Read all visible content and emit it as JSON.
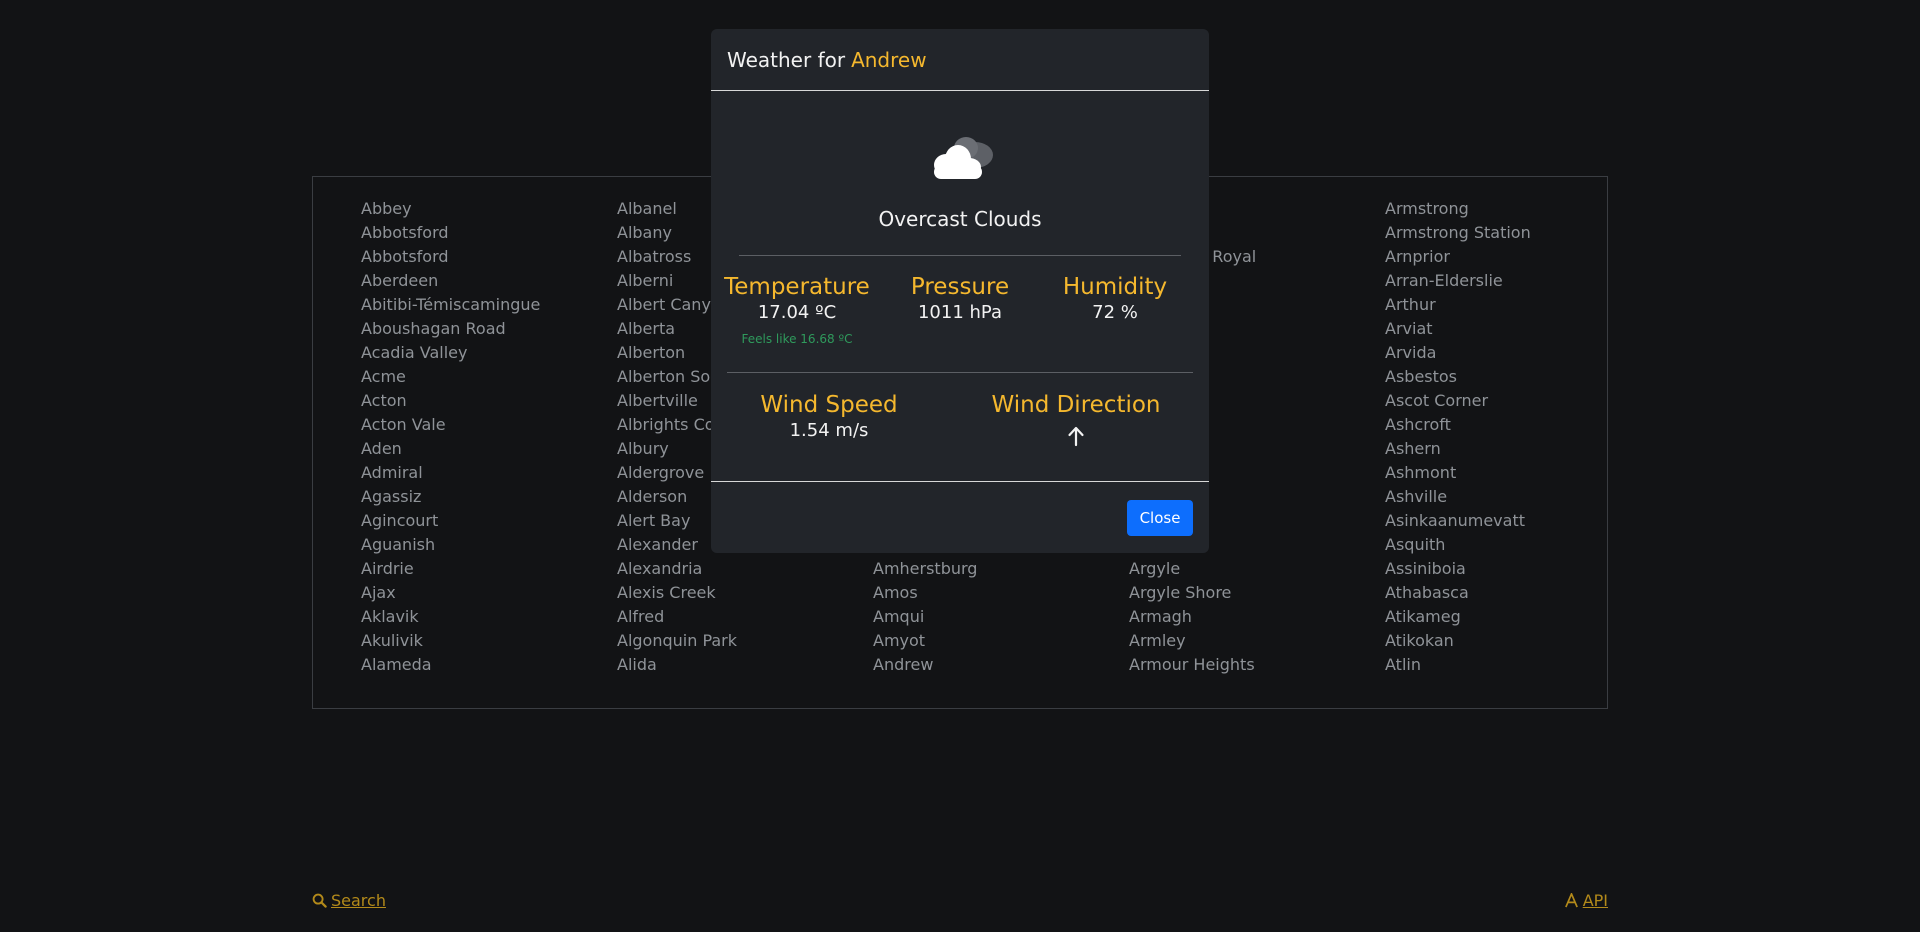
{
  "cities": {
    "col1": [
      "Abbey",
      "Abbotsford",
      "Abbotsford",
      "Aberdeen",
      "Abitibi-Témiscamingue",
      "Aboushagan Road",
      "Acadia Valley",
      "Acme",
      "Acton",
      "Acton Vale",
      "Aden",
      "Admiral",
      "Agassiz",
      "Agincourt",
      "Aguanish",
      "Airdrie",
      "Ajax",
      "Aklavik",
      "Akulivik",
      "Alameda"
    ],
    "col2": [
      "Albanel",
      "Albany",
      "Albatross",
      "Alberni",
      "Albert Canyon",
      "Alberta",
      "Alberton",
      "Alberton South",
      "Albertville",
      "Albrights Corner",
      "Albury",
      "Aldergrove",
      "Alderson",
      "Alert Bay",
      "Alexander",
      "Alexandria",
      "Alexis Creek",
      "Alfred",
      "Algonquin Park",
      "Alida"
    ],
    "col3": [
      "",
      "",
      "",
      "",
      "",
      "",
      "",
      "",
      "",
      "",
      "",
      "",
      "",
      "",
      "",
      "Amherstburg",
      "Amos",
      "Amqui",
      "Amyot",
      "Andrew"
    ],
    "col4": [
      "",
      "",
      "Annapolis Royal",
      "",
      "",
      "",
      "",
      "",
      "",
      "",
      "",
      "",
      "",
      "",
      "",
      "Argyle",
      "Argyle Shore",
      "Armagh",
      "Armley",
      "Armour Heights"
    ],
    "col5": [
      "Armstrong",
      "Armstrong Station",
      "Arnprior",
      "Arran-Elderslie",
      "Arthur",
      "Arviat",
      "Arvida",
      "Asbestos",
      "Ascot Corner",
      "Ashcroft",
      "Ashern",
      "Ashmont",
      "Ashville",
      "Asinkaanumevatt",
      "Asquith",
      "Assiniboia",
      "Athabasca",
      "Atikameg",
      "Atikokan",
      "Atlin"
    ]
  },
  "footer": {
    "search_label": "Search",
    "api_label": "API"
  },
  "modal": {
    "title_prefix": "Weather for",
    "city": "Andrew",
    "icon": "overcast-cloud-icon",
    "conditions": "Overcast Clouds",
    "temperature_label": "Temperature",
    "temperature_value": "17.04 ºC",
    "feels_like": "Feels like 16.68 ºC",
    "pressure_label": "Pressure",
    "pressure_value": "1011 hPa",
    "humidity_label": "Humidity",
    "humidity_value": "72 %",
    "wind_speed_label": "Wind Speed",
    "wind_speed_value": "1.54 m/s",
    "wind_direction_label": "Wind Direction",
    "wind_direction_icon": "arrow-up-icon",
    "close_label": "Close"
  },
  "colors": {
    "accent": "#f5b82e",
    "primary_button": "#0d6efd",
    "feels_like": "#2f9a5c",
    "background": "#121315",
    "modal_bg": "#22252a"
  }
}
